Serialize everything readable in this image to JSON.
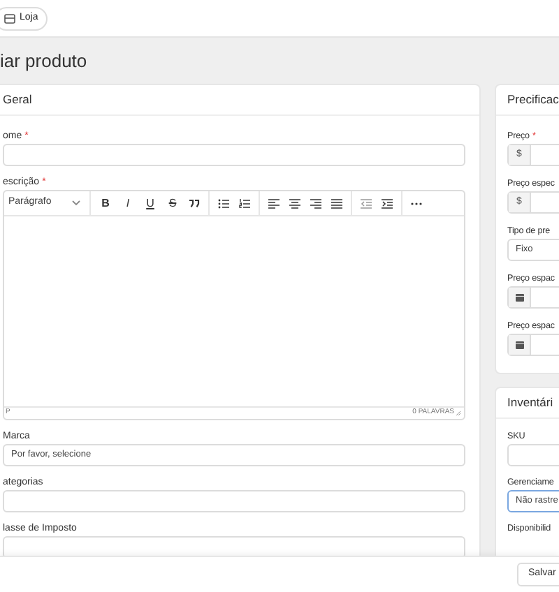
{
  "top_bar": {
    "store_button": "Loja"
  },
  "page_title": "iar produto",
  "general": {
    "title": "Geral",
    "fields": [
      {
        "kind": "text",
        "label": "ome",
        "required_mark": "*"
      },
      {
        "kind": "editor",
        "label": "escrição",
        "required_mark": "*",
        "format": "Parágrafo",
        "toolbar": [
          [
            {
              "kind": "bold",
              "label": "B"
            },
            {
              "kind": "italic",
              "label": "I"
            },
            {
              "kind": "underline",
              "label": "U"
            },
            {
              "kind": "strike",
              "label": "S"
            },
            {
              "kind": "quote"
            }
          ],
          [
            {
              "kind": "bullets"
            },
            {
              "kind": "numbers"
            }
          ],
          [
            {
              "kind": "left"
            },
            {
              "kind": "center"
            },
            {
              "kind": "right"
            },
            {
              "kind": "justify"
            }
          ],
          [
            {
              "kind": "outdent"
            },
            {
              "kind": "indent"
            }
          ],
          [
            {
              "kind": "more"
            }
          ]
        ],
        "path": "P",
        "word_count": "0 PALAVRAS"
      },
      {
        "kind": "select",
        "label": "Marca",
        "value": "Por favor, selecione"
      },
      {
        "kind": "text",
        "label": "ategorias"
      },
      {
        "kind": "text",
        "label": "lasse de Imposto"
      }
    ]
  },
  "pricing": {
    "title": "Precificac",
    "fields": [
      {
        "kind": "addon",
        "label": "Preço",
        "required_mark": "*",
        "addon": "$"
      },
      {
        "kind": "addon",
        "label": "Preço espec",
        "addon": "$"
      },
      {
        "kind": "select",
        "label": "Tipo de pre",
        "value": "Fixo"
      },
      {
        "kind": "date",
        "label": "Preço espac"
      },
      {
        "kind": "date",
        "label": "Preço espac"
      }
    ]
  },
  "inventory": {
    "title": "Inventári",
    "fields": [
      {
        "kind": "text",
        "label": "SKU"
      },
      {
        "kind": "select",
        "label": "Gerenciame",
        "value": "Não rastre",
        "focused": true
      },
      {
        "kind": "label",
        "label": "Disponibilid"
      }
    ]
  },
  "save_button": "Salvar"
}
